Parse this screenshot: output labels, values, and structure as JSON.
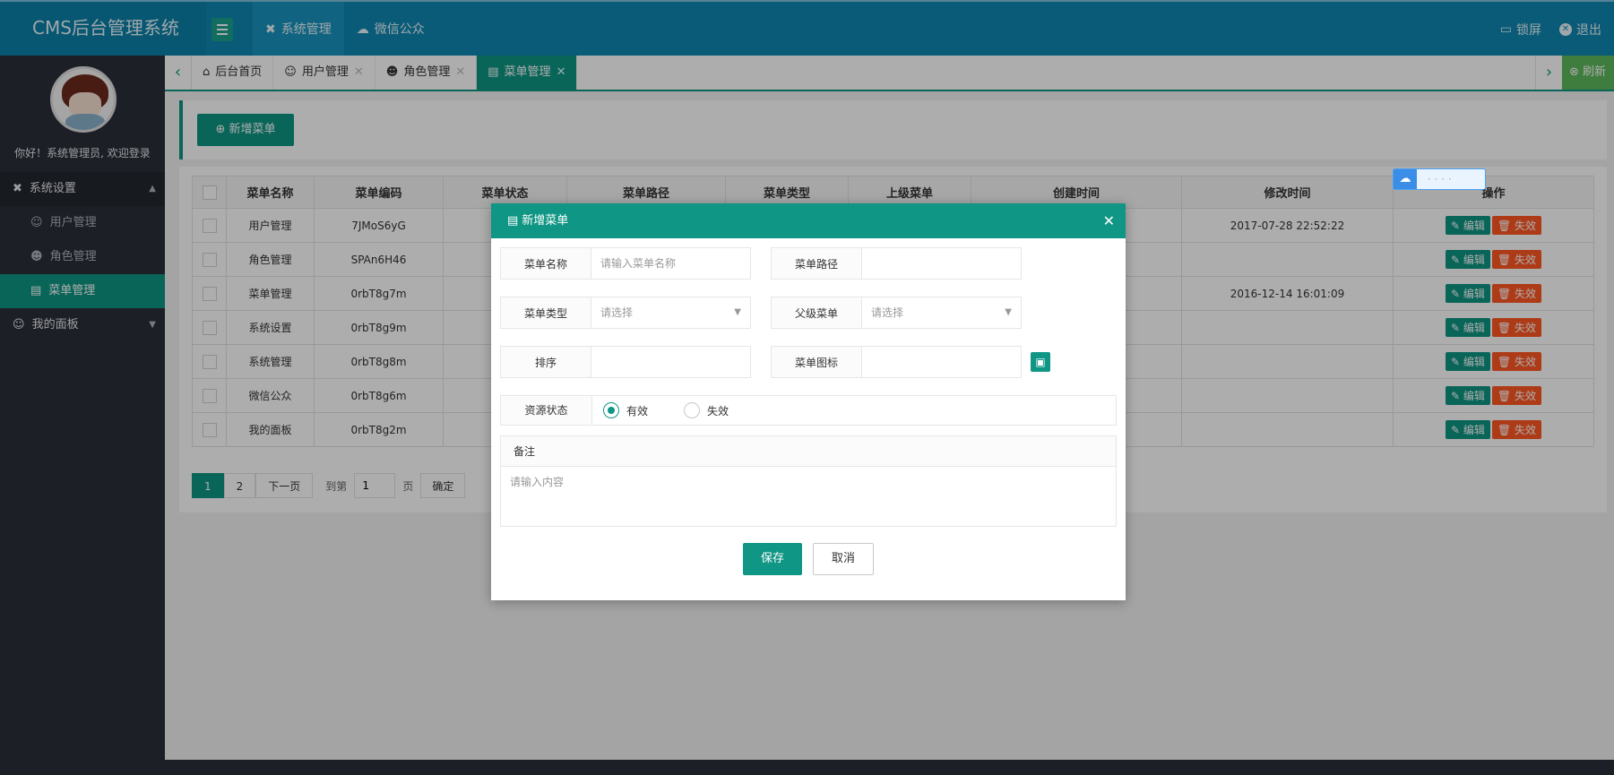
{
  "header": {
    "title": "CMS后台管理系统",
    "nav": [
      {
        "label": "系统管理",
        "icon": "tools-icon",
        "glyph": "✖"
      },
      {
        "label": "微信公众",
        "icon": "wechat-icon",
        "glyph": "☁"
      }
    ],
    "lock_label": "锁屏",
    "logout_label": "退出"
  },
  "sidebar": {
    "welcome": "你好！系统管理员, 欢迎登录",
    "groups": [
      {
        "label": "系统设置",
        "icon": "tools-icon",
        "glyph": "✖",
        "arrow": "▲"
      },
      {
        "label": "我的面板",
        "icon": "user-icon",
        "glyph": "☺",
        "arrow": "▼"
      }
    ],
    "items": [
      {
        "label": "用户管理",
        "icon": "user-icon",
        "glyph": "☺"
      },
      {
        "label": "角色管理",
        "icon": "role-icon",
        "glyph": "☻"
      },
      {
        "label": "菜单管理",
        "icon": "menu-icon",
        "glyph": "▤"
      }
    ]
  },
  "tabs": {
    "home": "后台首页",
    "list": [
      "用户管理",
      "角色管理",
      "菜单管理"
    ],
    "close": "✕",
    "refresh": "刷新"
  },
  "toolbar": {
    "add_label": "新增菜单"
  },
  "table": {
    "columns": [
      "菜单名称",
      "菜单编码",
      "菜单状态",
      "菜单路径",
      "菜单类型",
      "上级菜单",
      "创建时间",
      "修改时间",
      "操作"
    ],
    "rows": [
      {
        "name": "用户管理",
        "code": "7JMoS6yG",
        "modified": "2017-07-28 22:52:22"
      },
      {
        "name": "角色管理",
        "code": "SPAn6H46",
        "modified": ""
      },
      {
        "name": "菜单管理",
        "code": "0rbT8g7m",
        "modified": "2016-12-14 16:01:09"
      },
      {
        "name": "系统设置",
        "code": "0rbT8g9m",
        "modified": ""
      },
      {
        "name": "系统管理",
        "code": "0rbT8g8m",
        "modified": ""
      },
      {
        "name": "微信公众",
        "code": "0rbT8g6m",
        "modified": ""
      },
      {
        "name": "我的面板",
        "code": "0rbT8g2m",
        "modified": ""
      }
    ],
    "edit_label": "编辑",
    "disable_label": "失效"
  },
  "pager": {
    "pages": [
      "1",
      "2"
    ],
    "next": "下一页",
    "goto": "到第",
    "page_input": "1",
    "page_unit": "页",
    "confirm": "确定"
  },
  "modal": {
    "title": "新增菜单",
    "fields": {
      "name_label": "菜单名称",
      "name_placeholder": "请输入菜单名称",
      "path_label": "菜单路径",
      "type_label": "菜单类型",
      "type_placeholder": "请选择",
      "parent_label": "父级菜单",
      "parent_placeholder": "请选择",
      "sort_label": "排序",
      "icon_label": "菜单图标",
      "status_label": "资源状态",
      "status_valid": "有效",
      "status_invalid": "失效",
      "remark_label": "备注",
      "remark_placeholder": "请输入内容"
    },
    "save": "保存",
    "cancel": "取消"
  },
  "colors": {
    "header": "#0f87b2",
    "accent": "#0f9684",
    "danger": "#ff5722",
    "sidebar": "#2a2f38"
  }
}
